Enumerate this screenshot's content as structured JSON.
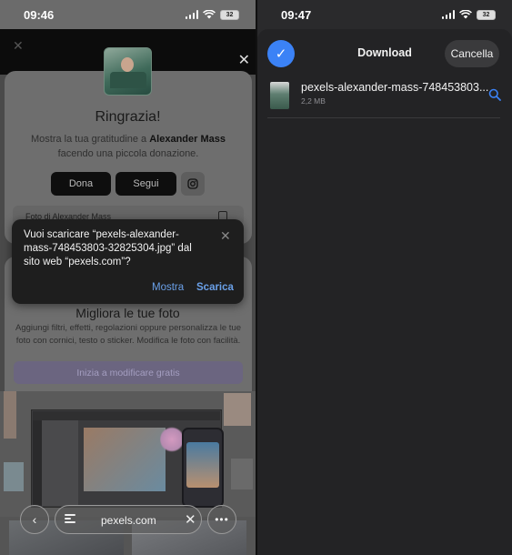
{
  "left": {
    "status": {
      "time": "09:46",
      "battery": "32"
    },
    "thanks": {
      "title": "Ringrazia!",
      "text_before": "Mostra la tua gratitudine a ",
      "author": "Alexander Mass",
      "text_after": " facendo una piccola donazione.",
      "dona_label": "Dona",
      "segui_label": "Segui",
      "credit": "Foto di Alexander Mass"
    },
    "dialog": {
      "message": "Vuoi scaricare “pexels-alexander-mass-748453803-32825304.jpg” dal sito web “pexels.com”?",
      "show_label": "Mostra",
      "download_label": "Scarica"
    },
    "edit": {
      "title": "Migliora le tue foto",
      "text": "Aggiungi filtri, effetti, regolazioni oppure personalizza le tue foto con cornici, testo o sticker. Modifica le foto con facilità.",
      "button_label": "Inizia a modificare gratis"
    },
    "navbar": {
      "url": "pexels.com",
      "back_icon": "chevron-left-icon",
      "tabs_icon": "tabs-icon",
      "close_icon": "close-icon",
      "more_icon": "more-icon"
    }
  },
  "right": {
    "status": {
      "time": "09:47",
      "battery": "32"
    },
    "header": {
      "title": "Download",
      "cancel_label": "Cancella",
      "confirm_icon": "checkmark-icon"
    },
    "file": {
      "name": "pexels-alexander-mass-748453803...",
      "size": "2,2 MB",
      "action_icon": "search-icon"
    }
  },
  "colors": {
    "accent": "#3b82f6",
    "dialog_link": "#6aa0e8"
  }
}
